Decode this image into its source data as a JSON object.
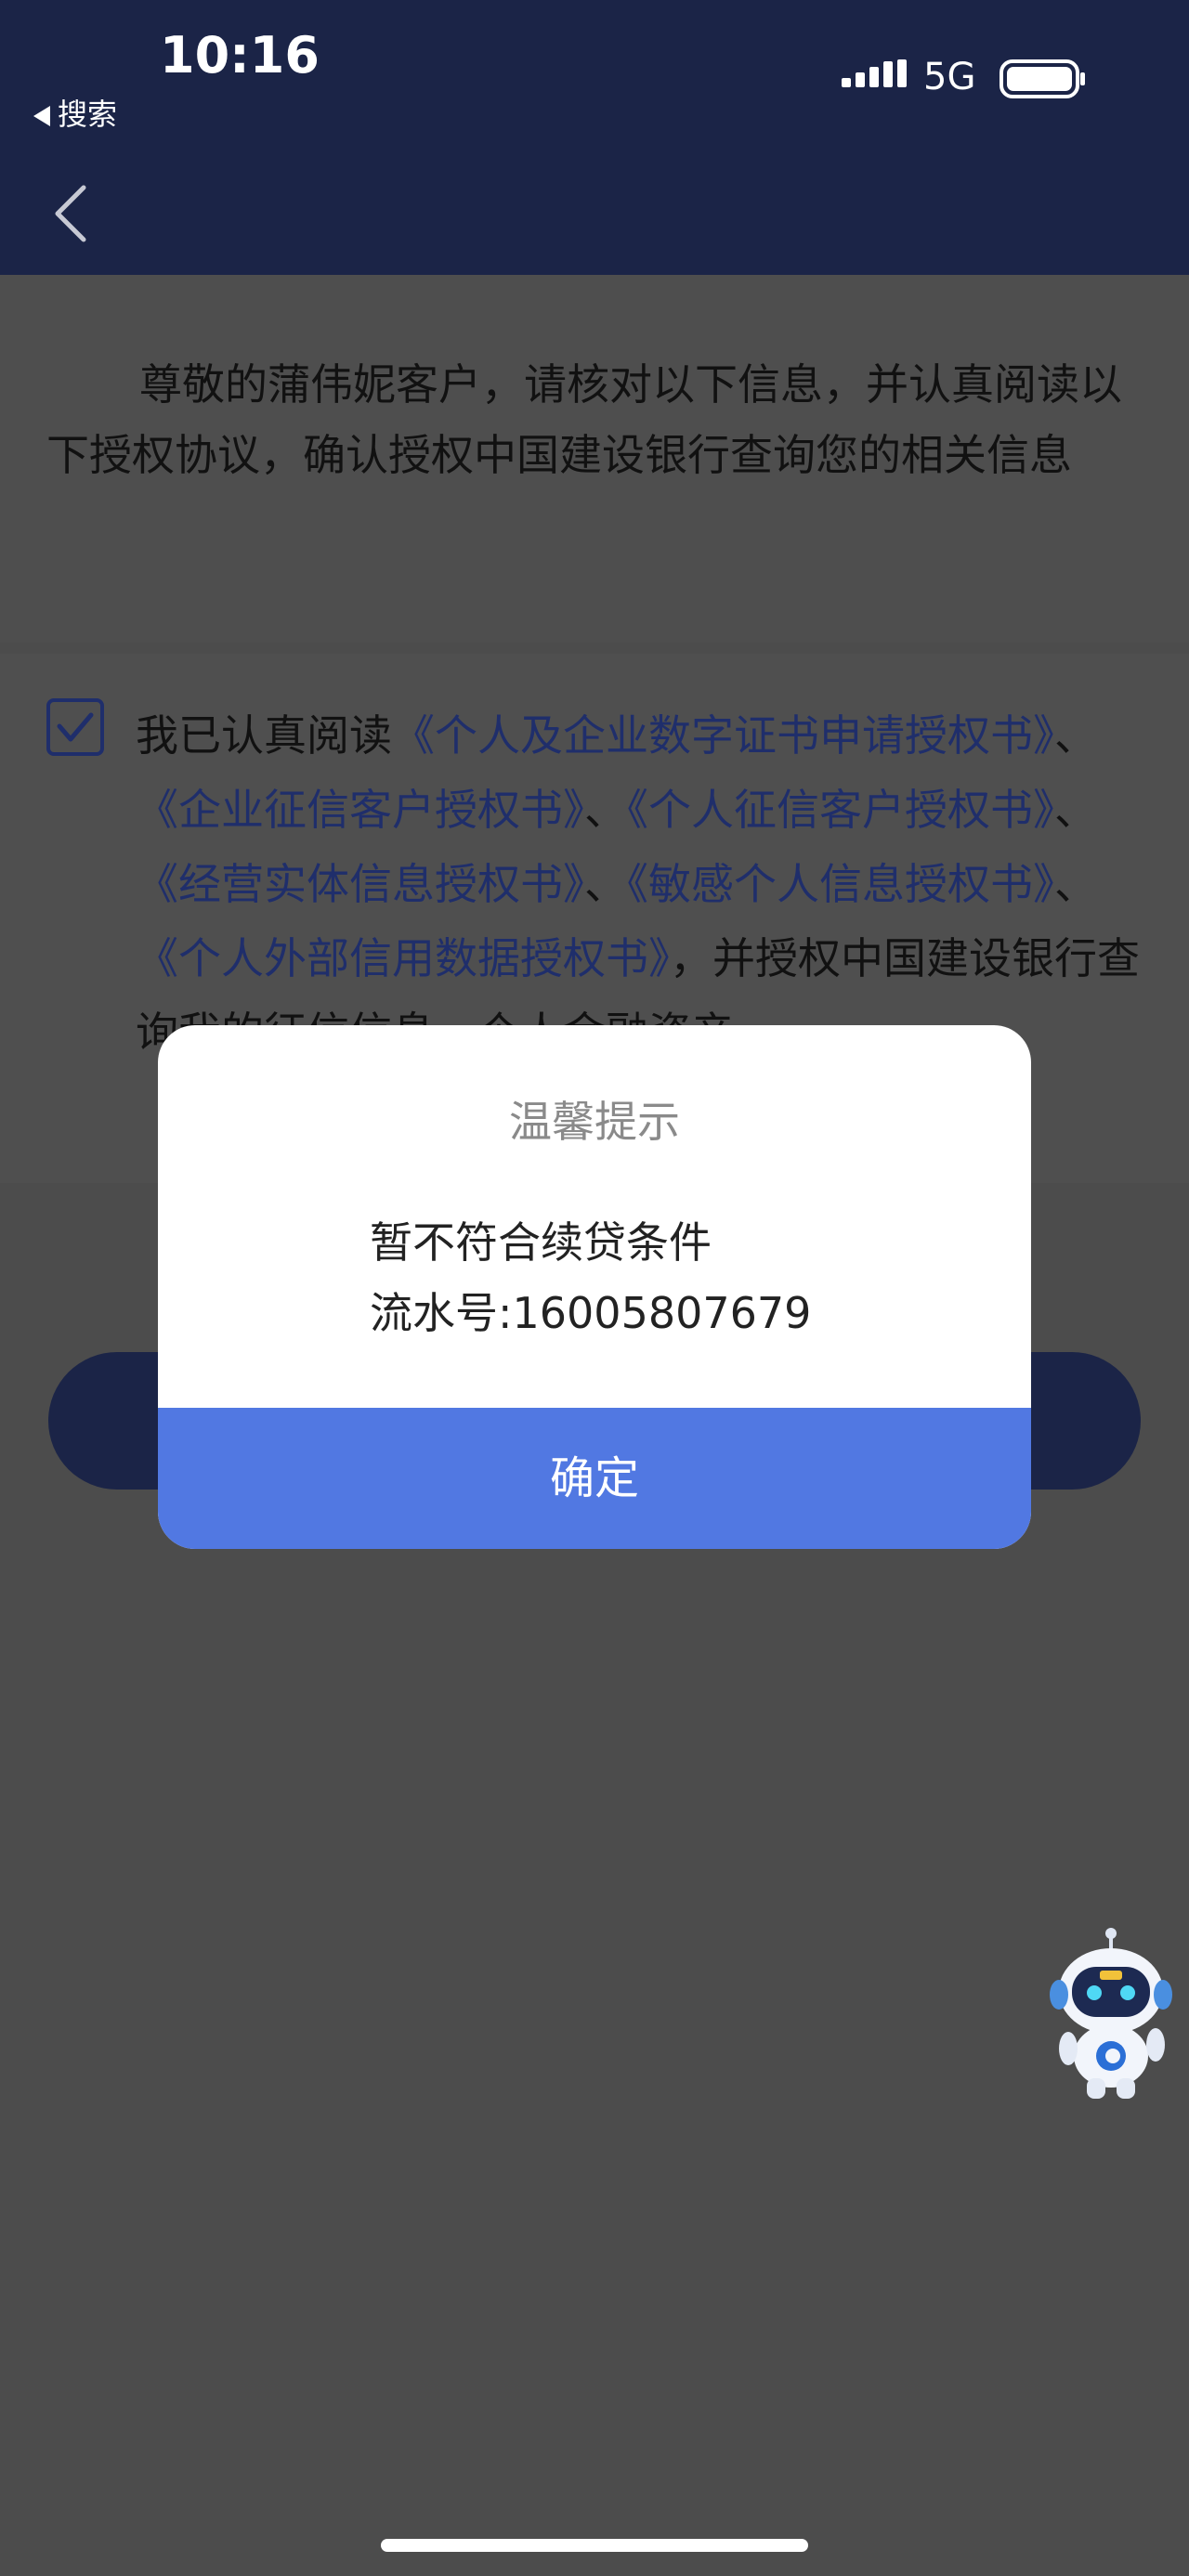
{
  "status_bar": {
    "time": "10:16",
    "back_app": "搜索",
    "network": "5G"
  },
  "intro_text": "尊敬的蒲伟妮客户，请核对以下信息，并认真阅读以下授权协议，确认授权中国建设银行查询您的相关信息",
  "agreement": {
    "checked": true,
    "prefix": "我已认真阅读",
    "links": [
      "《个人及企业数字证书申请授权书》",
      "《企业征信客户授权书》",
      "《个人征信客户授权书》",
      "《经营实体信息授权书》",
      "《敏感个人信息授权书》",
      "《个人外部信用数据授权书》"
    ],
    "separator": "、",
    "suffix": "，并授权中国建设银行查询我的征信信息、个人金融资产"
  },
  "dialog": {
    "title": "温馨提示",
    "message_line1": "暂不符合续贷条件",
    "message_line2": "流水号:16005807679",
    "confirm_label": "确定"
  },
  "colors": {
    "header_bg": "#1b2447",
    "dialog_button": "#5178e2",
    "link": "#1f2e6b",
    "overlay": "#4c4c4c"
  }
}
